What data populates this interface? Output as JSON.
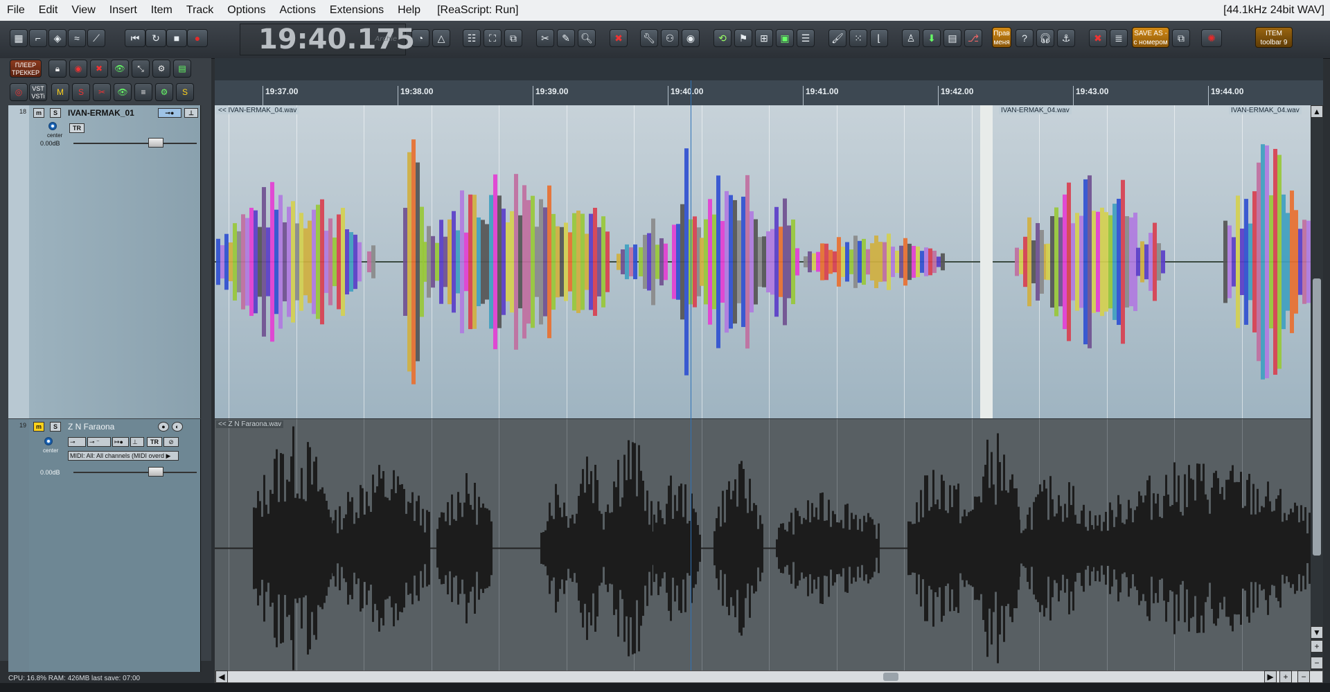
{
  "menu": {
    "items": [
      "File",
      "Edit",
      "View",
      "Insert",
      "Item",
      "Track",
      "Options",
      "Actions",
      "Extensions",
      "Help"
    ],
    "script_status": "[ReaScript: Run]",
    "format": "[44.1kHz 24bit WAV]"
  },
  "transport": {
    "time": "19:40.175",
    "time_sub": "Archie"
  },
  "toolbar_text": {
    "btn_pravy": "Прав\nменя",
    "btn_saveas": "SAVE AS -\nс номером",
    "btn_item": "ITEM\ntoolbar 9"
  },
  "mcp_buttons": {
    "player": "ПЛЕЕР\nТРЕККЕР",
    "vsti": "VST\nVSTi"
  },
  "tracks": [
    {
      "num": "18",
      "name": "IVAN-ERMAK_01",
      "pan": "center",
      "volume": "0.00dB",
      "tr": "TR",
      "color": "#9cb2be"
    },
    {
      "num": "19",
      "name": "Z N Faraona",
      "pan": "center",
      "volume": "0.00dB",
      "tr": "TR",
      "midi": "MIDI: All: All channels (MIDI overd ▶",
      "color": "#6e8794"
    }
  ],
  "ruler": {
    "labels": [
      "19:37.00",
      "19:38.00",
      "19:39.00",
      "19:40.00",
      "19:41.00",
      "19:42.00",
      "19:43.00",
      "19:44.00"
    ]
  },
  "items": {
    "lane1": [
      "<< IVAN-ERMAK_04.wav",
      "IVAN-ERMAK_04.wav",
      "IVAN-ERMAK_04.wav"
    ],
    "lane2": [
      "<< Z N Faraona.wav"
    ]
  },
  "status": "CPU: 16.8%  RAM: 426MB  last save: 07:00",
  "colors": {
    "accent": "#2f73b8",
    "record": "#e32b2b"
  }
}
